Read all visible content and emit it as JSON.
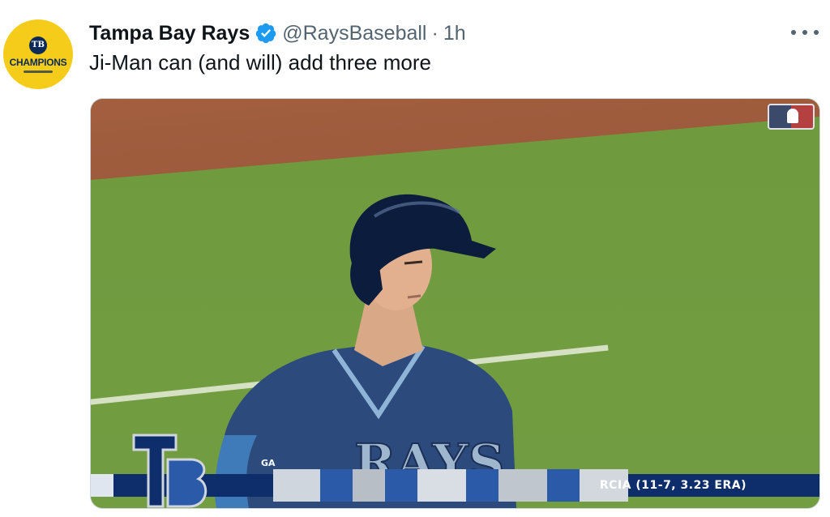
{
  "tweet": {
    "author_name": "Tampa Bay Rays",
    "handle": "@RaysBaseball",
    "separator": "·",
    "time": "1h",
    "text": "Ji-Man can (and will) add three more"
  },
  "avatar": {
    "badge": "TB",
    "label": "CHAMPIONS",
    "color": "#f5cc1a"
  },
  "media": {
    "scorebar_text": "RCIA (11-7, 3.23 ERA)",
    "scorebar_prefix": "GA",
    "jersey_text": "RAYS"
  },
  "icons": {
    "verified": "verified-badge-icon",
    "more": "more-options-icon",
    "league": "mlb-logo-icon"
  },
  "colors": {
    "verified_blue": "#1d9bf0",
    "handle_gray": "#536471",
    "navy": "#0e2d6b"
  }
}
